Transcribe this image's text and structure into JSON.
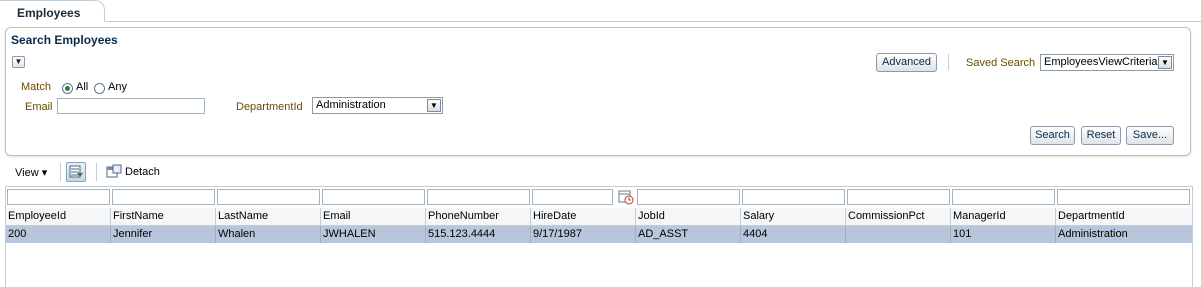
{
  "tabs": [
    {
      "label": "Employees",
      "active": true
    }
  ],
  "search_panel": {
    "title": "Search Employees",
    "disclose_icon": "chevron-down-icon",
    "match_label": "Match",
    "match_options": [
      "All",
      "Any"
    ],
    "match_selected": "All",
    "email_label": "Email",
    "email_value": "",
    "department_label": "DepartmentId",
    "department_value": "Administration",
    "advanced_button": "Advanced",
    "saved_search_label": "Saved Search",
    "saved_search_value": "EmployeesViewCriteria",
    "search_button": "Search",
    "reset_button": "Reset",
    "save_button": "Save..."
  },
  "toolbar": {
    "view_label": "View ▾",
    "detach_label": "Detach",
    "filter_icon": "query-by-example-icon",
    "detach_icon": "detach-icon"
  },
  "table": {
    "columns": [
      "EmployeeId",
      "FirstName",
      "LastName",
      "Email",
      "PhoneNumber",
      "HireDate",
      "JobId",
      "Salary",
      "CommissionPct",
      "ManagerId",
      "DepartmentId"
    ],
    "rows": [
      [
        "200",
        "Jennifer",
        "Whalen",
        "JWHALEN",
        "515.123.4444",
        "9/17/1987",
        "AD_ASST",
        "4404",
        "",
        "101",
        "Administration"
      ]
    ],
    "selected_row": 0,
    "date_filter_icon": "calendar-icon"
  },
  "colors": {
    "accent": "#0b2a48",
    "selected_row": "#b7c6da",
    "label": "#6b4a00"
  }
}
